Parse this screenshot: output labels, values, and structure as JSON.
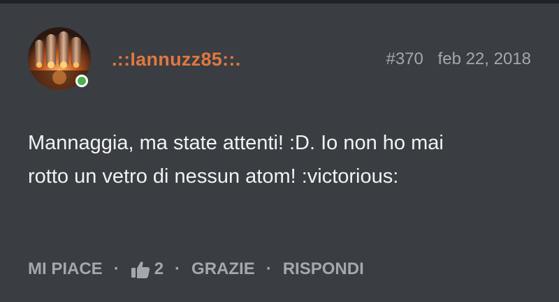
{
  "post": {
    "username": ".::Iannuzz85::.",
    "post_number": "#370",
    "date": "feb 22, 2018",
    "online": true,
    "message": "Mannaggia, ma state attenti! :D. Io non ho mai rotto un vetro di nessun atom! :victorious:"
  },
  "actions": {
    "like_label": "MI PIACE",
    "separator": "·",
    "like_count": "2",
    "thanks_label": "GRAZIE",
    "reply_label": "RISPONDI"
  },
  "colors": {
    "background": "#3a3d42",
    "username": "#e07840",
    "meta_text": "#a4a8ad",
    "message_text": "#f1f2f3",
    "online_indicator": "#4caf50"
  },
  "icons": {
    "like": "thumbs-up-icon"
  }
}
